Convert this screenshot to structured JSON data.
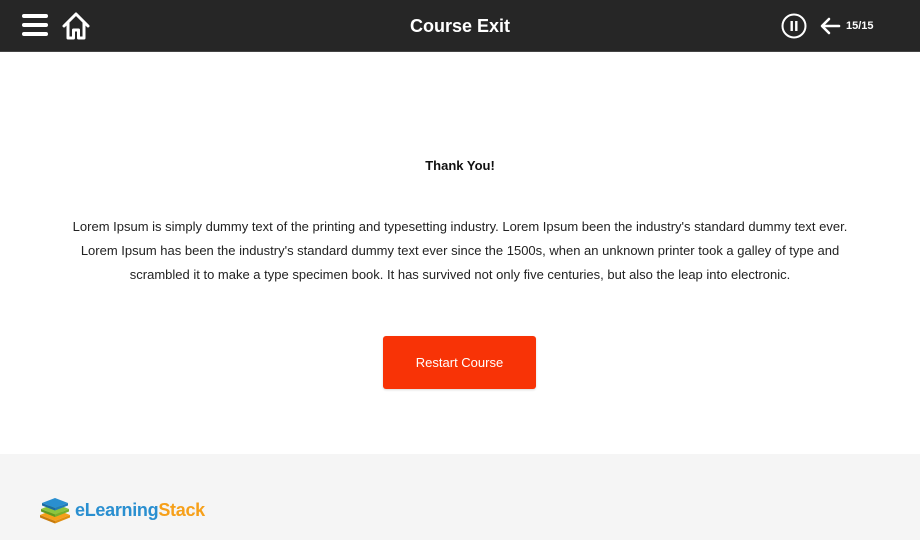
{
  "header": {
    "title": "Course Exit",
    "page_indicator": "15/15",
    "icons": [
      "menu-icon",
      "home-icon",
      "pause-icon",
      "back-arrow-icon"
    ],
    "background_color": "#262626"
  },
  "main": {
    "heading": "Thank You!",
    "body": "Lorem Ipsum is simply dummy text of the printing and typesetting industry. Lorem Ipsum been the industry's standard dummy text ever. Lorem Ipsum has been the industry's standard dummy text ever since the 1500s, when an unknown printer took a galley of type and scrambled it to make a type specimen book. It has survived not only five centuries, but also the leap into electronic.",
    "restart_label": "Restart Course",
    "accent_color": "#f83306"
  },
  "footer": {
    "logo_part1": "eLearning",
    "logo_part2": "Stack",
    "logo_colors": [
      "#2a8fd0",
      "#f6a01a"
    ]
  }
}
